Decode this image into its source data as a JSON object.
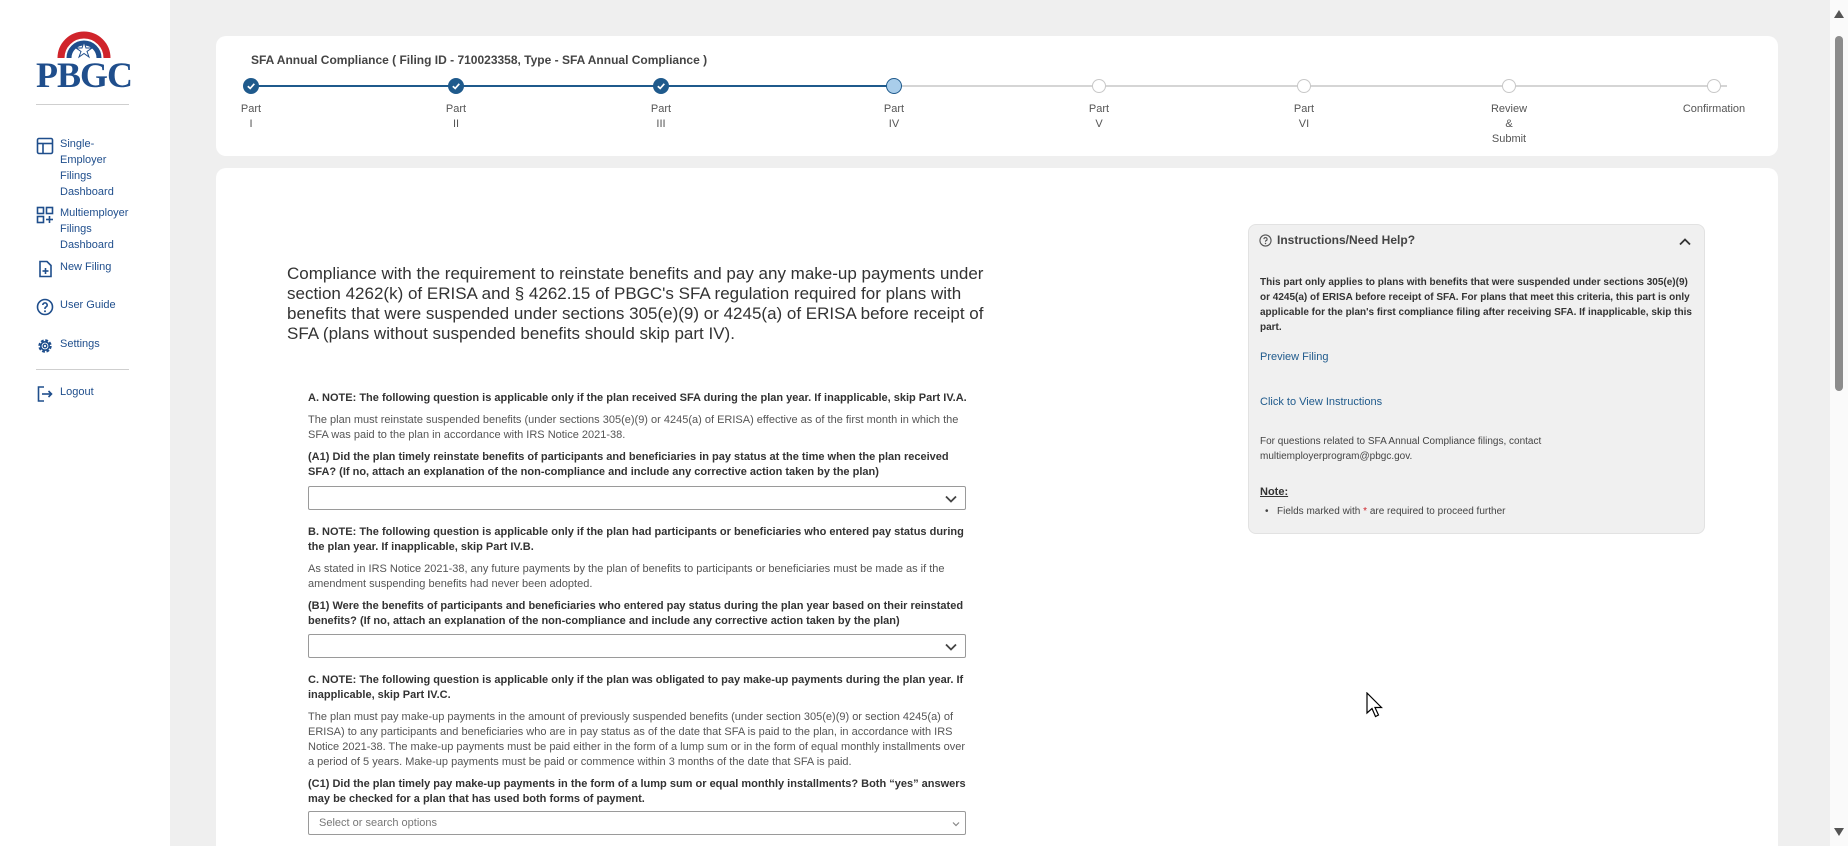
{
  "brand": {
    "logo_text": "PBGC"
  },
  "sidebar": {
    "items": [
      {
        "label": "Single-Employer Filings Dashboard",
        "icon": "table-icon"
      },
      {
        "label": "Multiemployer Filings Dashboard",
        "icon": "grid-plus-icon"
      },
      {
        "label": "New Filing",
        "icon": "file-plus-icon"
      },
      {
        "label": "User Guide",
        "icon": "question-circle-icon"
      },
      {
        "label": "Settings",
        "icon": "gear-icon"
      },
      {
        "label": "Logout",
        "icon": "logout-icon"
      }
    ]
  },
  "stepper": {
    "title": "SFA Annual Compliance ( Filing ID - 710023358, Type - SFA Annual Compliance )",
    "steps": [
      {
        "label": "Part\nI",
        "status": "done"
      },
      {
        "label": "Part\nII",
        "status": "done"
      },
      {
        "label": "Part\nIII",
        "status": "done"
      },
      {
        "label": "Part\nIV",
        "status": "current"
      },
      {
        "label": "Part\nV",
        "status": "todo"
      },
      {
        "label": "Part\nVI",
        "status": "todo"
      },
      {
        "label": "Review\n&\nSubmit",
        "status": "todo"
      },
      {
        "label": "Confirmation",
        "status": "todo"
      }
    ]
  },
  "main": {
    "heading": "Compliance with the requirement to reinstate benefits and pay any make-up payments under section 4262(k) of ERISA and § 4262.15 of PBGC's SFA regulation required for plans with benefits that were suspended under sections 305(e)(9) or 4245(a) of ERISA before receipt of SFA (plans without suspended benefits should skip part IV).",
    "section_a": {
      "note": "A. NOTE: The following question is applicable only if the plan received SFA during the plan year. If inapplicable, skip Part IV.A.",
      "desc": "The plan must reinstate suspended benefits (under sections 305(e)(9) or 4245(a) of ERISA) effective as of the first month in which the SFA was paid to the plan in accordance with IRS Notice 2021-38.",
      "question": "(A1) Did the plan timely reinstate benefits of participants and beneficiaries in pay status at the time when the plan received SFA? (If no, attach an explanation of the non-compliance and include any corrective action taken by the plan)",
      "value": ""
    },
    "section_b": {
      "note": "B. NOTE: The following question is applicable only if the plan had participants or beneficiaries who entered pay status during the plan year. If inapplicable, skip Part IV.B.",
      "desc": "As stated in IRS Notice 2021-38, any future payments by the plan of benefits to participants or beneficiaries must be made as if the amendment suspending benefits had never been adopted.",
      "question": "(B1) Were the benefits of participants and beneficiaries who entered pay status during the plan year based on their reinstated benefits? (If no, attach an explanation of the non-compliance and include any corrective action taken by the plan)",
      "value": ""
    },
    "section_c": {
      "note": "C. NOTE: The following question is applicable only if the plan was obligated to pay make-up payments during the plan year. If inapplicable, skip Part IV.C.",
      "desc": "The plan must pay make-up payments in the amount of previously suspended benefits (under section 305(e)(9) or section 4245(a) of ERISA) to any participants and beneficiaries who are in pay status as of the date that SFA is paid to the plan, in accordance with IRS Notice 2021-38. The make-up payments must be paid either in the form of a lump sum or in the form of equal monthly installments over a period of 5 years. Make-up payments must be paid or commence within 3 months of the date that SFA is paid.",
      "question": "(C1) Did the plan timely pay make-up payments in the form of a lump sum or equal monthly installments? Both “yes” answers may be checked for a plan that has used both forms of payment.",
      "placeholder": "Select or search options"
    }
  },
  "help": {
    "title": "Instructions/Need Help?",
    "body": "This part only applies to plans with benefits that were suspended under sections 305(e)(9) or 4245(a) of ERISA before receipt of SFA. For plans that meet this criteria, this part is only applicable for the plan's first compliance filing after receiving SFA. If inapplicable, skip this part.",
    "preview_link": "Preview Filing",
    "instructions_link": "Click to View Instructions",
    "contact": "For questions related to SFA Annual Compliance filings, contact multiemployerprogram@pbgc.gov.",
    "note_label": "Note:",
    "note_item_pre": "Fields marked with ",
    "note_item_star": "*",
    "note_item_post": " are required to proceed further"
  },
  "colors": {
    "primary": "#1f5a8c",
    "brand_red": "#d0242b",
    "page_bg": "#efefef"
  }
}
